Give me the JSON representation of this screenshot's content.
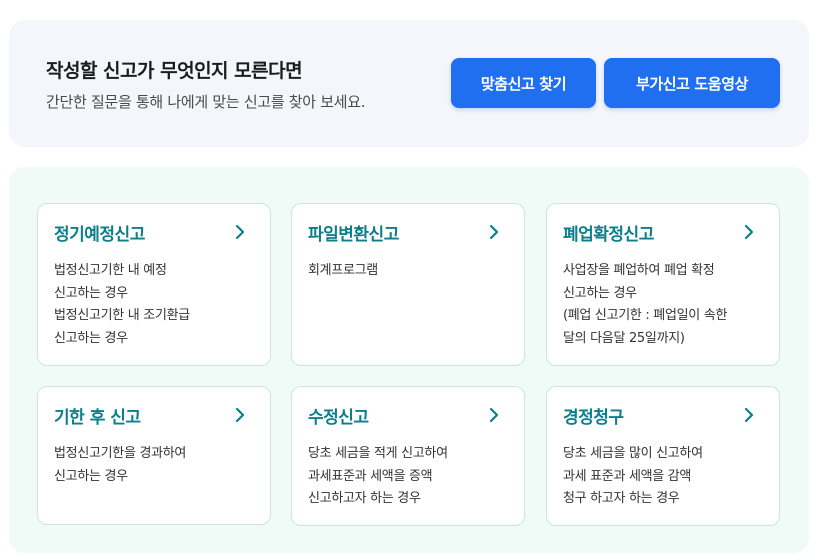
{
  "banner": {
    "title": "작성할 신고가 무엇인지 모른다면",
    "subtitle": "간단한 질문을 통해 나에게 맞는 신고를 찾아 보세요.",
    "buttons": [
      "맞춤신고 찾기",
      "부가신고 도움영상"
    ]
  },
  "colors": {
    "accent": "#1f6ff0",
    "card_title": "#0b7f8a",
    "panel_bg": "#f0faf7",
    "banner_bg": "#f4f6fb"
  },
  "cards": [
    {
      "title": "정기예정신고",
      "icon": "chevron-right-icon",
      "lines": [
        "법정신고기한 내 예정",
        "신고하는 경우",
        "법정신고기한 내 조기환급",
        "신고하는 경우"
      ]
    },
    {
      "title": "파일변환신고",
      "icon": "chevron-right-icon",
      "lines": [
        "회계프로그램"
      ]
    },
    {
      "title": "폐업확정신고",
      "icon": "chevron-right-icon",
      "lines": [
        "사업장을 폐업하여 폐업 확정",
        "신고하는 경우",
        "(폐업 신고기한 : 폐업일이 속한",
        "달의 다음달 25일까지)"
      ]
    },
    {
      "title": "기한 후 신고",
      "icon": "chevron-right-icon",
      "lines": [
        "법정신고기한을 경과하여",
        "신고하는 경우"
      ]
    },
    {
      "title": "수정신고",
      "icon": "chevron-right-icon",
      "lines": [
        "당초 세금을 적게 신고하여",
        "과세표준과 세액을 증액",
        "신고하고자 하는 경우"
      ]
    },
    {
      "title": "경정청구",
      "icon": "chevron-right-icon",
      "lines": [
        "당초 세금을 많이 신고하여",
        "과세 표준과 세액을 감액",
        "청구 하고자 하는 경우"
      ]
    }
  ]
}
